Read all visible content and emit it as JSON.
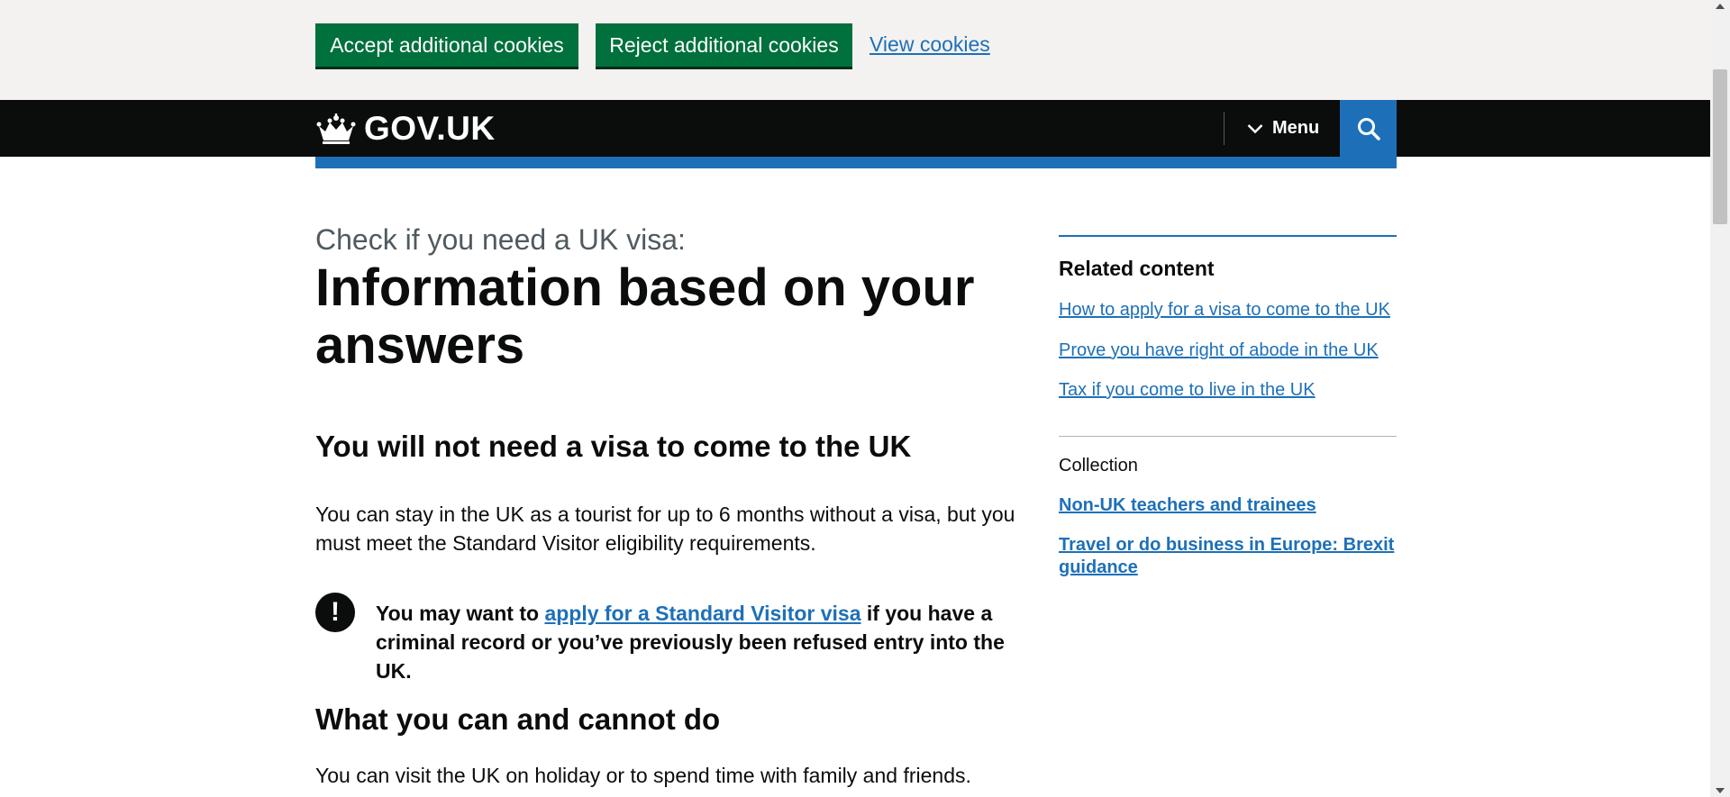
{
  "cookie_banner": {
    "accept_label": "Accept additional cookies",
    "reject_label": "Reject additional cookies",
    "view_label": "View cookies"
  },
  "header": {
    "logo_text": "GOV.UK",
    "logo_icon": "crown-icon",
    "menu_label": "Menu",
    "menu_icon": "chevron-down-icon",
    "search_icon": "search-icon"
  },
  "main": {
    "caption": "Check if you need a UK visa:",
    "title": "Information based on your answers",
    "heading_visa": "You will not need a visa to come to the UK",
    "para_tourist": "You can stay in the UK as a tourist for up to 6 months without a visa, but you must meet the Standard Visitor eligibility requirements.",
    "warning": {
      "icon": "!",
      "text_before": "You may want to ",
      "link": "apply for a Standard Visitor visa",
      "text_after": " if you have a criminal record or you’ve previously been refused entry into the UK."
    },
    "heading_do": "What you can and cannot do",
    "para_holiday": "You can visit the UK on holiday or to spend time with family and friends."
  },
  "sidebar": {
    "related_heading": "Related content",
    "related_links": [
      "How to apply for a visa to come to the UK",
      "Prove you have right of abode in the UK",
      "Tax if you come to live in the UK"
    ],
    "collection_label": "Collection",
    "collection_links": [
      "Non-UK teachers and trainees",
      "Travel or do business in Europe: Brexit guidance"
    ]
  },
  "colors": {
    "button_green": "#00703c",
    "link_blue": "#1d70b8",
    "header_black": "#0b0c0c",
    "banner_grey": "#f3f2f1"
  }
}
